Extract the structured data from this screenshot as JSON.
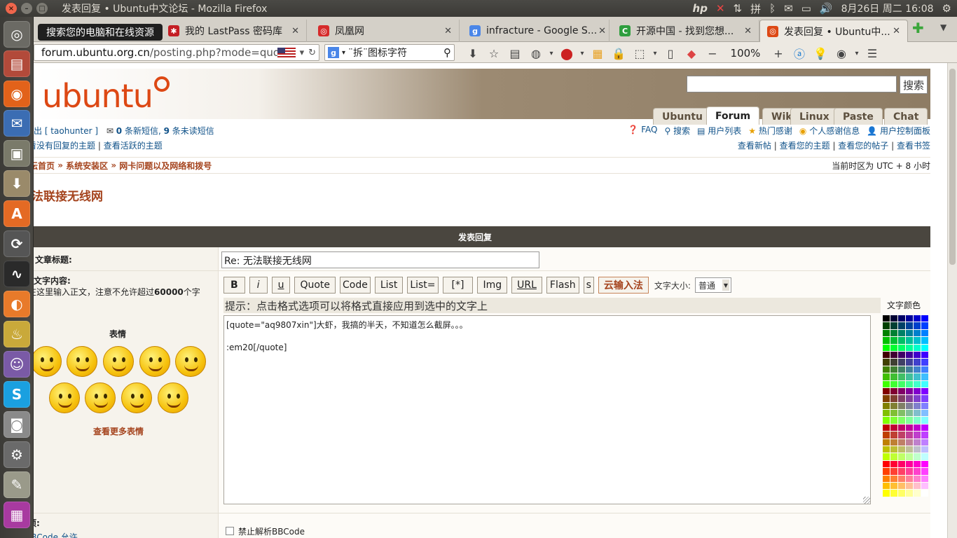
{
  "window": {
    "title": "发表回复 • Ubuntu中文论坛 - Mozilla Firefox"
  },
  "tray": {
    "hp_icon": "hp-icon",
    "input_method": "拼",
    "datetime": "8月26日 周二 16:08"
  },
  "launcher": {
    "tooltip": "搜索您的电脑和在线资源"
  },
  "tabs": [
    {
      "label": "我的 LastPass 密码库"
    },
    {
      "label": "凤凰网"
    },
    {
      "label": "infracture - Google S..."
    },
    {
      "label": "开源中国 - 找到您想..."
    },
    {
      "label": "发表回复 • Ubuntu中..."
    }
  ],
  "url": {
    "host": "forum.ubuntu.org.cn",
    "path": "/posting.php?mode=quote"
  },
  "search": {
    "engine": "g",
    "query": "¨拆¨图标字符"
  },
  "zoom": "100%",
  "forum": {
    "search_button": "搜索",
    "nav_tabs": [
      "Ubuntu",
      "Forum",
      "Wiki",
      "Linux",
      "Paste",
      "Chat"
    ],
    "active_tab": "Forum",
    "userbar": {
      "logout": "退出 [ taohunter ]",
      "new_pm_count": "0",
      "new_pm_text": "条新短信,",
      "unread_pm_count": "9",
      "unread_pm_text": "条未读短信",
      "links_left": [
        "查看没有回复的主题",
        "查看活跃的主题"
      ],
      "links_top_right": [
        "FAQ",
        "搜索",
        "用户列表",
        "热门感谢",
        "个人感谢信息",
        "用户控制面板"
      ],
      "links_bottom_right": [
        "查看新帖",
        "查看您的主题",
        "查看您的帖子",
        "查看书签"
      ]
    },
    "breadcrumb": [
      "论坛首页",
      "系统安装区",
      "网卡问题以及网络和拨号"
    ],
    "timezone": "当前时区为 UTC + 8 小时",
    "topic_title": "无法联接无线网",
    "post_header": "发表回复",
    "subject_label": "文章标题:",
    "subject_value": "Re: 无法联接无线网",
    "body_label": "文字内容:",
    "body_hint_pre": "请在这里输入正文，注意不允许超过",
    "body_hint_limit": "60000",
    "body_hint_post": "个字符。",
    "smilies_title": "表情",
    "more_smilies": "查看更多表情",
    "bbcode_buttons": [
      "B",
      "i",
      "u",
      "Quote",
      "Code",
      "List",
      "List=",
      "[*]",
      "Img",
      "URL",
      "Flash",
      "s",
      "云输入法"
    ],
    "font_size_label": "文字大小:",
    "font_size_value": "普通",
    "hint": "提示：点击格式选项可以将格式直接应用到选中的文字上",
    "message": "[quote=\"aq9807xin\"]大虾，我搞的半天，不知道怎么截屏。。。\n\n:em20[/quote]",
    "color_title": "文字颜色",
    "options_label": "选项:",
    "options_sub": "BBCode 允许",
    "disable_bbcode": "禁止解析BBCode"
  }
}
